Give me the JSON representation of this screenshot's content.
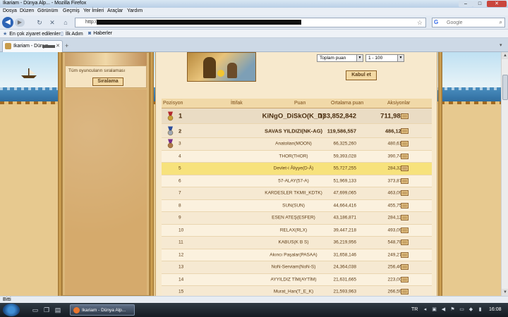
{
  "window": {
    "title": "Ikariam - Dünya Alp... - Mozilla Firefox"
  },
  "menu": [
    "Dosya",
    "Düzen",
    "Görünüm",
    "Geçmiş",
    "Yer İmleri",
    "Araçlar",
    "Yardım"
  ],
  "nav": {
    "url": "http://",
    "search_placeholder": "Google"
  },
  "bookmarks": [
    "En çok ziyaret edilenler",
    "İlk Adım",
    "Haberler"
  ],
  "tab": {
    "label": "Ikariam - Dünya"
  },
  "sidebar": {
    "caption": "Tüm oyuncuların sıralaması",
    "button": "Sıralama"
  },
  "filters": {
    "type_selected": "Toplam puan",
    "range_selected": "1 - 100",
    "submit": "Kabul et"
  },
  "table": {
    "headers": [
      "Pozisyon",
      "İttifak",
      "Puan",
      "Ortalama puan",
      "Aksiyonlar"
    ],
    "rows": [
      {
        "pos": "1",
        "name": "KiNgO_DiSkO(K_D)",
        "points": "133,852,842",
        "avg": "711,983"
      },
      {
        "pos": "2",
        "name": "SAVAS YILDIZI(NK-AG)",
        "points": "119,586,557",
        "avg": "486,124"
      },
      {
        "pos": "3",
        "name": "Anatolian(MOON)",
        "points": "66,325,260",
        "avg": "480,618"
      },
      {
        "pos": "4",
        "name": "THOR(THOR)",
        "points": "59,393,028",
        "avg": "390,744"
      },
      {
        "pos": "5",
        "name": "Devlet-i Âliyye(D-Â)",
        "points": "55,727,255",
        "avg": "284,323"
      },
      {
        "pos": "6",
        "name": "57-ALAY(57-A)",
        "points": "51,969,133",
        "avg": "373,879"
      },
      {
        "pos": "7",
        "name": "KARDESLER TKMII_KDTK)",
        "points": "47,699,065",
        "avg": "463,098"
      },
      {
        "pos": "8",
        "name": "SUN(SUN)",
        "points": "44,664,416",
        "avg": "455,759"
      },
      {
        "pos": "9",
        "name": "ESEN ATEŞ(ESFER)",
        "points": "43,186,871",
        "avg": "284,124"
      },
      {
        "pos": "10",
        "name": "RELAX(RLX)",
        "points": "39,447,218",
        "avg": "493,090"
      },
      {
        "pos": "11",
        "name": "KABUS(K B S)",
        "points": "36,219,956",
        "avg": "548,787"
      },
      {
        "pos": "12",
        "name": "Akıncı Paşalar(PASAA)",
        "points": "31,658,146",
        "avg": "249,277"
      },
      {
        "pos": "13",
        "name": "NoN-Serviam(NoN-S)",
        "points": "24,364,038",
        "avg": "256,464"
      },
      {
        "pos": "14",
        "name": "AYYILDIZ TİM(AYTİM)",
        "points": "21,631,665",
        "avg": "223,007"
      },
      {
        "pos": "15",
        "name": "Murat_Han(T_E_K)",
        "points": "21,593,963",
        "avg": "266,592"
      }
    ]
  },
  "status": {
    "text": "Bitti"
  },
  "taskbar": {
    "task_label": "Ikariam - Dünya Alp...",
    "lang": "TR",
    "clock": "16:08"
  },
  "colors": {
    "highlight_row": "#f7e27c",
    "parchment": "#f7e9cd",
    "text_brown": "#5c3a14"
  }
}
